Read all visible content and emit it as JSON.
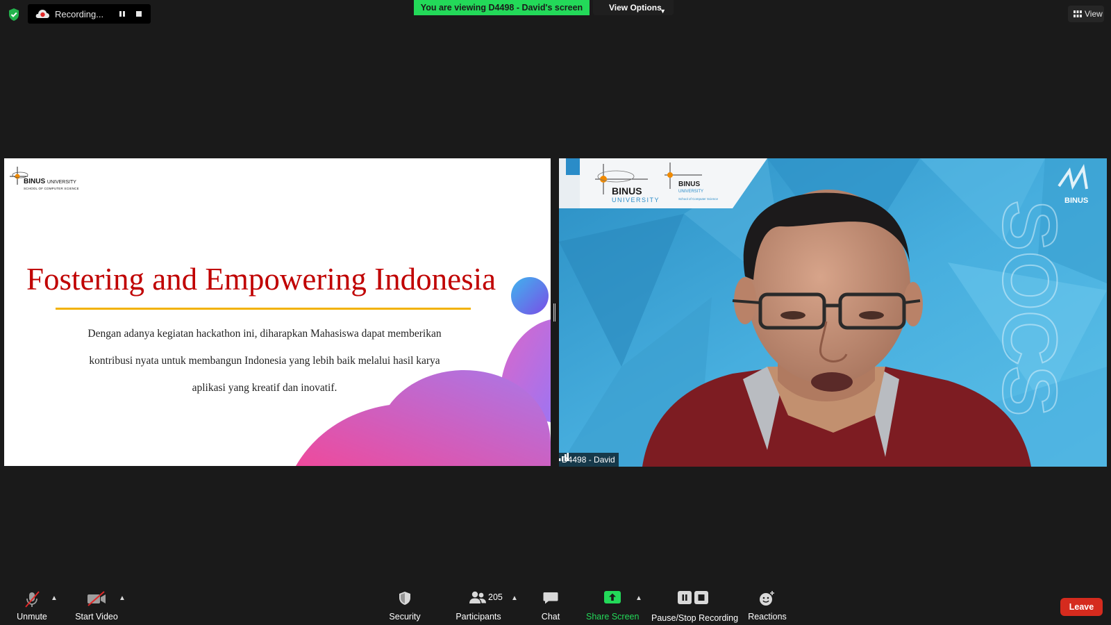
{
  "top_bar": {
    "recording_label": "Recording...",
    "viewing_banner": "You are viewing D4498 - David's screen",
    "view_options_label": "View Options",
    "view_button_label": "View"
  },
  "shared_slide": {
    "logo_word": "BINUS",
    "logo_word_suffix": "UNIVERSITY",
    "logo_subtitle": "SCHOOL OF COMPUTER SCIENCE",
    "title": "Fostering and Empowering Indonesia",
    "body_lines": [
      "Dengan adanya kegiatan hackathon ini, diharapkan Mahasiswa dapat memberikan",
      "kontribusi nyata untuk membangun Indonesia yang lebih baik melalui hasil karya",
      "aplikasi yang kreatif dan inovatif."
    ]
  },
  "speaker_video": {
    "name_tag": "D4498 - David",
    "backdrop_logo_1": "BINUS",
    "backdrop_logo_1_sub": "UNIVERSITY",
    "backdrop_logo_2": "BINUS",
    "backdrop_logo_2_sub": "UNIVERSITY",
    "backdrop_logo_2_detail": "School of Computer Science",
    "backdrop_corner_logo": "BINUS",
    "backdrop_side_text": "SOCS"
  },
  "toolbar": {
    "unmute_label": "Unmute",
    "start_video_label": "Start Video",
    "security_label": "Security",
    "participants_label": "Participants",
    "participants_count": "205",
    "chat_label": "Chat",
    "share_screen_label": "Share Screen",
    "pause_stop_recording_label": "Pause/Stop Recording",
    "reactions_label": "Reactions",
    "leave_label": "Leave"
  },
  "colors": {
    "app_background": "#1a1a1a",
    "banner_green": "#23d959",
    "leave_red": "#d52b1e",
    "slide_title_red": "#c00000",
    "slide_rule_gold": "#f2b200",
    "mute_slash_red": "#e02828"
  },
  "icons": {
    "security": "shield-icon",
    "recording": "cloud-record-icon",
    "participants": "people-icon",
    "chat": "chat-bubble-icon",
    "share": "share-arrow-icon",
    "reactions": "smiley-plus-icon",
    "mic": "mic-off-icon",
    "video": "video-off-icon"
  }
}
